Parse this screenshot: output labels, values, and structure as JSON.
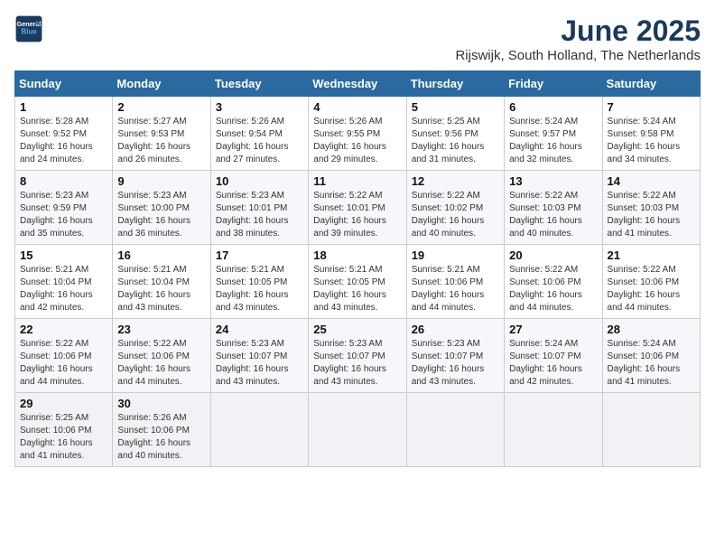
{
  "header": {
    "logo_line1": "General",
    "logo_line2": "Blue",
    "month": "June 2025",
    "location": "Rijswijk, South Holland, The Netherlands"
  },
  "days_of_week": [
    "Sunday",
    "Monday",
    "Tuesday",
    "Wednesday",
    "Thursday",
    "Friday",
    "Saturday"
  ],
  "weeks": [
    [
      {
        "day": 1,
        "sunrise": "5:28 AM",
        "sunset": "9:52 PM",
        "daylight": "16 hours and 24 minutes."
      },
      {
        "day": 2,
        "sunrise": "5:27 AM",
        "sunset": "9:53 PM",
        "daylight": "16 hours and 26 minutes."
      },
      {
        "day": 3,
        "sunrise": "5:26 AM",
        "sunset": "9:54 PM",
        "daylight": "16 hours and 27 minutes."
      },
      {
        "day": 4,
        "sunrise": "5:26 AM",
        "sunset": "9:55 PM",
        "daylight": "16 hours and 29 minutes."
      },
      {
        "day": 5,
        "sunrise": "5:25 AM",
        "sunset": "9:56 PM",
        "daylight": "16 hours and 31 minutes."
      },
      {
        "day": 6,
        "sunrise": "5:24 AM",
        "sunset": "9:57 PM",
        "daylight": "16 hours and 32 minutes."
      },
      {
        "day": 7,
        "sunrise": "5:24 AM",
        "sunset": "9:58 PM",
        "daylight": "16 hours and 34 minutes."
      }
    ],
    [
      {
        "day": 8,
        "sunrise": "5:23 AM",
        "sunset": "9:59 PM",
        "daylight": "16 hours and 35 minutes."
      },
      {
        "day": 9,
        "sunrise": "5:23 AM",
        "sunset": "10:00 PM",
        "daylight": "16 hours and 36 minutes."
      },
      {
        "day": 10,
        "sunrise": "5:23 AM",
        "sunset": "10:01 PM",
        "daylight": "16 hours and 38 minutes."
      },
      {
        "day": 11,
        "sunrise": "5:22 AM",
        "sunset": "10:01 PM",
        "daylight": "16 hours and 39 minutes."
      },
      {
        "day": 12,
        "sunrise": "5:22 AM",
        "sunset": "10:02 PM",
        "daylight": "16 hours and 40 minutes."
      },
      {
        "day": 13,
        "sunrise": "5:22 AM",
        "sunset": "10:03 PM",
        "daylight": "16 hours and 40 minutes."
      },
      {
        "day": 14,
        "sunrise": "5:22 AM",
        "sunset": "10:03 PM",
        "daylight": "16 hours and 41 minutes."
      }
    ],
    [
      {
        "day": 15,
        "sunrise": "5:21 AM",
        "sunset": "10:04 PM",
        "daylight": "16 hours and 42 minutes."
      },
      {
        "day": 16,
        "sunrise": "5:21 AM",
        "sunset": "10:04 PM",
        "daylight": "16 hours and 43 minutes."
      },
      {
        "day": 17,
        "sunrise": "5:21 AM",
        "sunset": "10:05 PM",
        "daylight": "16 hours and 43 minutes."
      },
      {
        "day": 18,
        "sunrise": "5:21 AM",
        "sunset": "10:05 PM",
        "daylight": "16 hours and 43 minutes."
      },
      {
        "day": 19,
        "sunrise": "5:21 AM",
        "sunset": "10:06 PM",
        "daylight": "16 hours and 44 minutes."
      },
      {
        "day": 20,
        "sunrise": "5:22 AM",
        "sunset": "10:06 PM",
        "daylight": "16 hours and 44 minutes."
      },
      {
        "day": 21,
        "sunrise": "5:22 AM",
        "sunset": "10:06 PM",
        "daylight": "16 hours and 44 minutes."
      }
    ],
    [
      {
        "day": 22,
        "sunrise": "5:22 AM",
        "sunset": "10:06 PM",
        "daylight": "16 hours and 44 minutes."
      },
      {
        "day": 23,
        "sunrise": "5:22 AM",
        "sunset": "10:06 PM",
        "daylight": "16 hours and 44 minutes."
      },
      {
        "day": 24,
        "sunrise": "5:23 AM",
        "sunset": "10:07 PM",
        "daylight": "16 hours and 43 minutes."
      },
      {
        "day": 25,
        "sunrise": "5:23 AM",
        "sunset": "10:07 PM",
        "daylight": "16 hours and 43 minutes."
      },
      {
        "day": 26,
        "sunrise": "5:23 AM",
        "sunset": "10:07 PM",
        "daylight": "16 hours and 43 minutes."
      },
      {
        "day": 27,
        "sunrise": "5:24 AM",
        "sunset": "10:07 PM",
        "daylight": "16 hours and 42 minutes."
      },
      {
        "day": 28,
        "sunrise": "5:24 AM",
        "sunset": "10:06 PM",
        "daylight": "16 hours and 41 minutes."
      }
    ],
    [
      {
        "day": 29,
        "sunrise": "5:25 AM",
        "sunset": "10:06 PM",
        "daylight": "16 hours and 41 minutes."
      },
      {
        "day": 30,
        "sunrise": "5:26 AM",
        "sunset": "10:06 PM",
        "daylight": "16 hours and 40 minutes."
      },
      null,
      null,
      null,
      null,
      null
    ]
  ]
}
